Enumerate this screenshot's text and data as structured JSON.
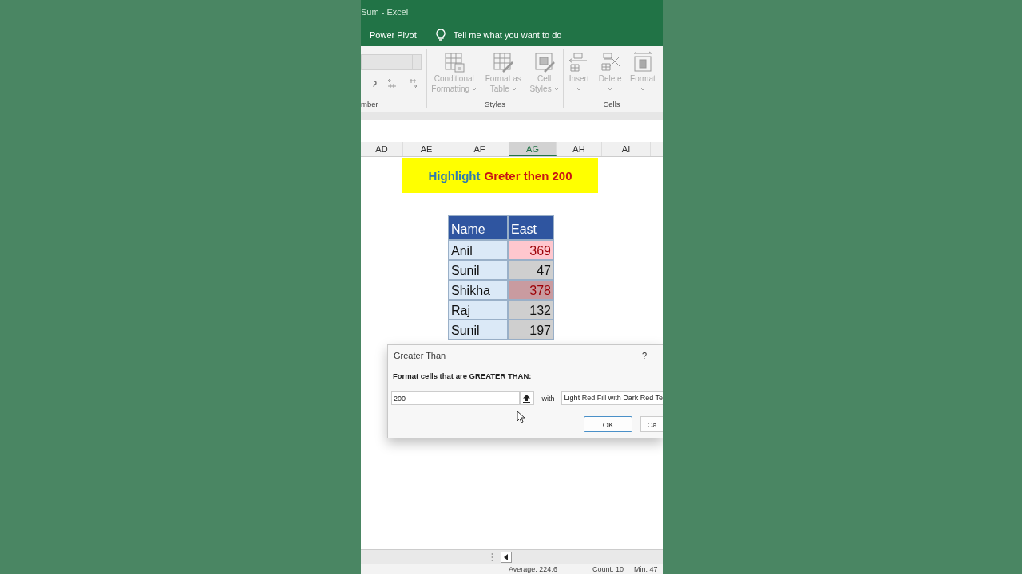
{
  "window": {
    "title": "Sum  -  Excel"
  },
  "menu": {
    "tab": "Power Pivot",
    "tell_me": "Tell me what you want to do"
  },
  "ribbon": {
    "number_group": {
      "label": "mber"
    },
    "styles_group": {
      "label": "Styles",
      "buttons": [
        {
          "kind": "conditional",
          "lines": [
            "Conditional",
            "Formatting"
          ],
          "disabled": true
        },
        {
          "kind": "table",
          "lines": [
            "Format as",
            "Table"
          ],
          "disabled": true
        },
        {
          "kind": "styles",
          "lines": [
            "Cell",
            "Styles"
          ],
          "disabled": true
        }
      ]
    },
    "cells_group": {
      "label": "Cells",
      "buttons": [
        {
          "kind": "insert",
          "label": "Insert",
          "disabled": true
        },
        {
          "kind": "delete",
          "label": "Delete",
          "disabled": true
        },
        {
          "kind": "format",
          "label": "Format",
          "disabled": true
        }
      ]
    }
  },
  "columns": [
    {
      "label": "AD",
      "selected": false
    },
    {
      "label": "AE",
      "selected": false
    },
    {
      "label": "AF",
      "selected": false
    },
    {
      "label": "AG",
      "selected": true
    },
    {
      "label": "AH",
      "selected": false
    },
    {
      "label": "AI",
      "selected": false
    }
  ],
  "banner": {
    "parts": [
      {
        "text": "Highlight",
        "color": "#2f7bb0"
      },
      {
        "text": "Greter then 200",
        "color": "#c81414"
      }
    ]
  },
  "table": {
    "headers": [
      "Name",
      "East"
    ],
    "rows": [
      {
        "name": "Anil",
        "east": "369",
        "highlighted": true,
        "active": true
      },
      {
        "name": "Sunil",
        "east": "47",
        "highlighted": false,
        "active": false
      },
      {
        "name": "Shikha",
        "east": "378",
        "highlighted": true,
        "active": false
      },
      {
        "name": "Raj",
        "east": "132",
        "highlighted": false,
        "active": false
      },
      {
        "name": "Sunil",
        "east": "197",
        "highlighted": false,
        "active": false
      }
    ]
  },
  "dialog": {
    "title": "Greater Than",
    "help": "?",
    "prompt": "Format cells that are GREATER THAN:",
    "value": "200",
    "with": "with",
    "format": "Light Red Fill with Dark Red Te",
    "buttons": [
      {
        "label": "OK",
        "default": true
      },
      {
        "label": "Ca",
        "default": false
      }
    ]
  },
  "status_bar": [
    "Average: 224.6",
    "Count: 10",
    "Min: 47"
  ]
}
